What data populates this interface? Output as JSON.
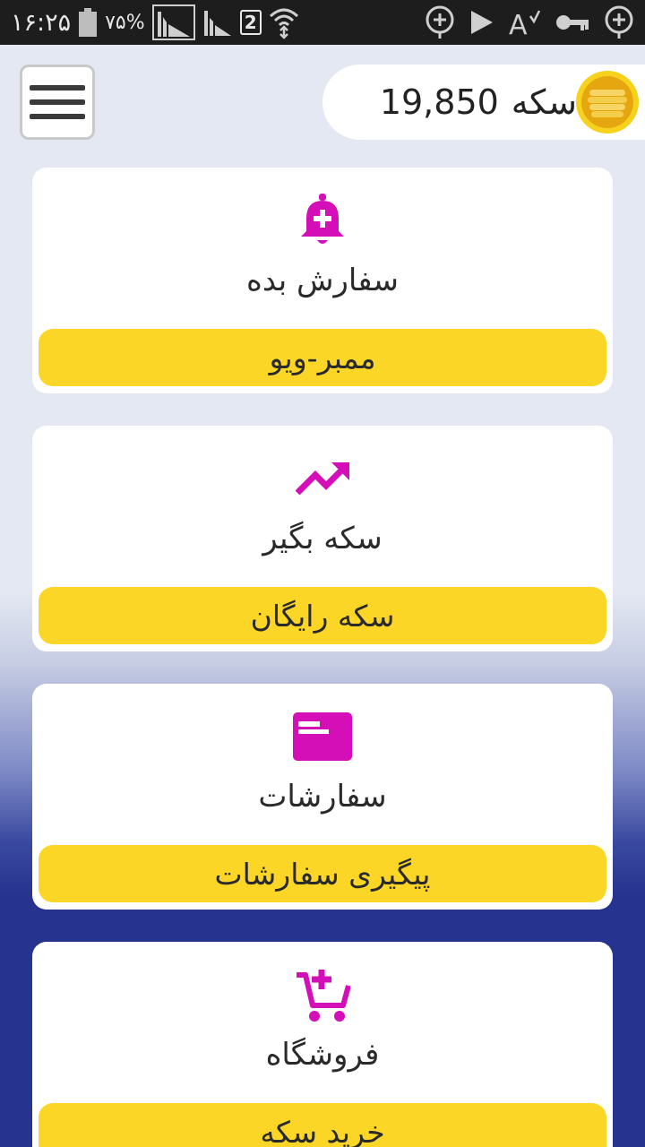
{
  "status_bar": {
    "time": "۱۶:۲۵",
    "battery_percent": "۷۵%",
    "sim_slot": "2"
  },
  "header": {
    "coin_label": "سکه",
    "coin_amount": "19,850",
    "menu_icon": "hamburger-icon",
    "coin_icon": "coin-stack-icon"
  },
  "cards": [
    {
      "icon": "bell-plus-icon",
      "title": "سفارش بده",
      "button": "ممبر-ویو"
    },
    {
      "icon": "trending-up-icon",
      "title": "سکه بگیر",
      "button": "سکه رایگان"
    },
    {
      "icon": "orders-card-icon",
      "title": "سفارشات",
      "button": "پیگیری سفارشات"
    },
    {
      "icon": "cart-plus-icon",
      "title": "فروشگاه",
      "button": "خرید سکه"
    }
  ],
  "colors": {
    "accent": "#d40fb7",
    "button_yellow": "#fbd626",
    "coin_gold": "#e8b10e",
    "bg_light": "#e4e8f3",
    "bg_dark": "#26338f"
  }
}
